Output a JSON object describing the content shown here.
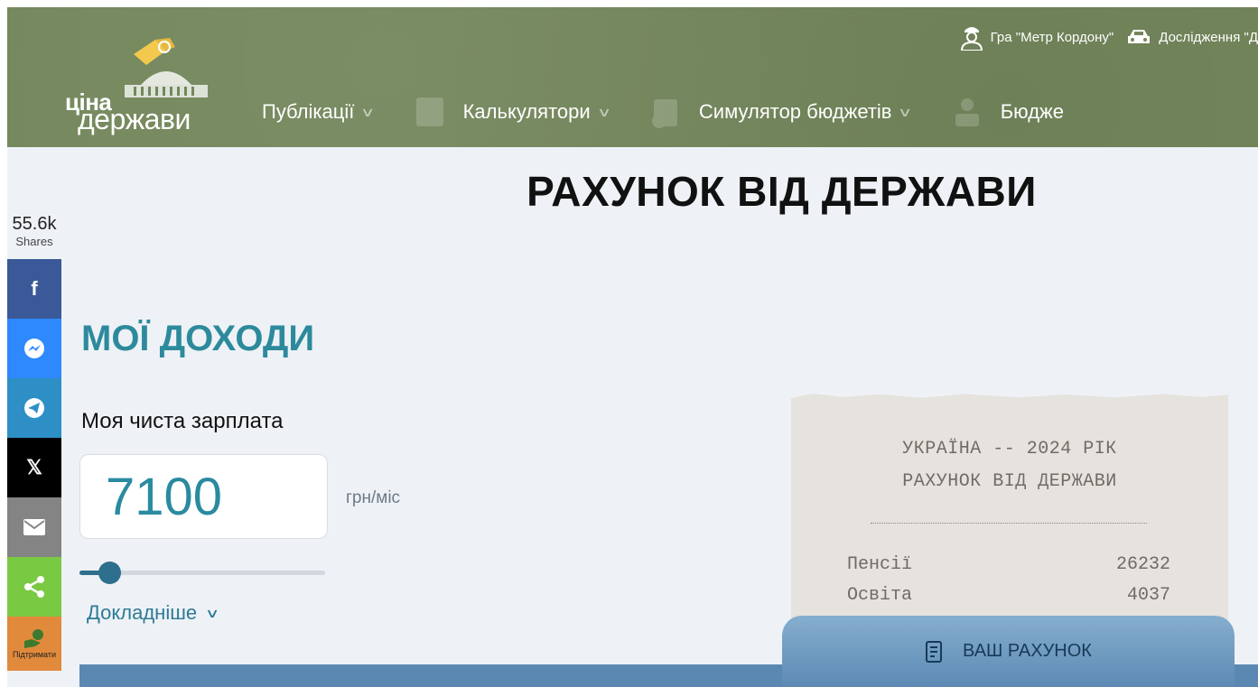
{
  "header": {
    "logo": {
      "word1": "ціна",
      "word2": "держави"
    },
    "top_links": [
      {
        "icon": "officer-icon",
        "label": "Гра \"Метр Кордону\""
      },
      {
        "icon": "car-icon",
        "label": "Дослідження \"Д"
      }
    ],
    "nav": [
      {
        "label": "Публікації"
      },
      {
        "label": "Калькулятори"
      },
      {
        "label": "Симулятор бюджетів"
      },
      {
        "label": "Бюдже"
      }
    ]
  },
  "share": {
    "count": "55.6k",
    "count_label": "Shares",
    "buttons": [
      {
        "network": "facebook",
        "color": "#3b5998",
        "glyph": "f"
      },
      {
        "network": "messenger",
        "color": "#2e89ff",
        "glyph": "✉"
      },
      {
        "network": "telegram",
        "color": "#2e8fc7",
        "glyph": "➤"
      },
      {
        "network": "x",
        "color": "#000000",
        "glyph": "𝕏"
      },
      {
        "network": "email",
        "color": "#848484",
        "glyph": "✉"
      },
      {
        "network": "sharethis",
        "color": "#7ac943",
        "glyph": "<"
      }
    ],
    "support_label": "Підтримати"
  },
  "page": {
    "title": "РАХУНОК ВІД ДЕРЖАВИ",
    "section_title": "МОЇ ДОХОДИ",
    "salary_label": "Моя чиста зарплата",
    "salary_value": "7100",
    "salary_unit": "грн/міс",
    "slider_fraction": 0.12,
    "more_label": "Докладніше"
  },
  "receipt": {
    "line1": "УКРАЇНА -- 2024 РІК",
    "line2": "РАХУНОК ВІД ДЕРЖАВИ",
    "rows": [
      {
        "label": "Пенсії",
        "value": "26232"
      },
      {
        "label": "Освіта",
        "value": "4037"
      }
    ],
    "button_label": "ВАШ РАХУНОК"
  }
}
